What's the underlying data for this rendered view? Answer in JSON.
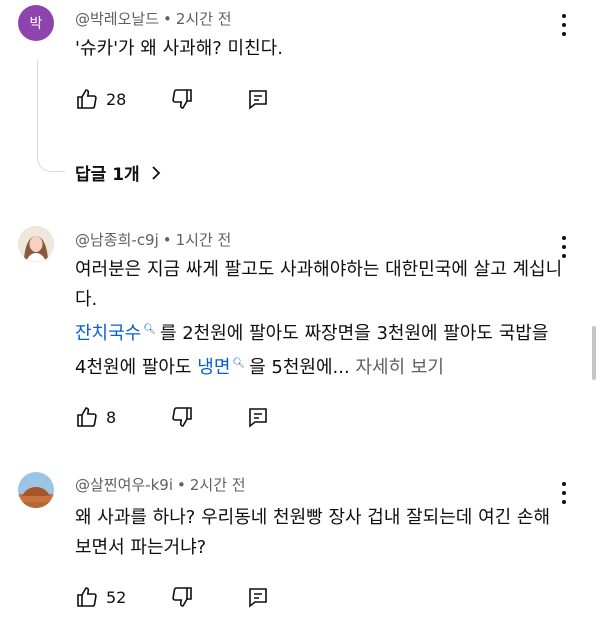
{
  "comments": [
    {
      "avatar_initial": "박",
      "avatar_color": "#8e44ad",
      "author": "@박레오날드",
      "time": "2시간 전",
      "text": "'슈카'가 왜 사과해? 미친다.",
      "likes": "28",
      "replies_label": "답글 1개"
    },
    {
      "author": "@남종희-c9j",
      "time": "1시간 전",
      "text_part1": "여러분은 지금 싸게 팔고도 사과해야하는 대한민국에 살고 계십니다.",
      "link1": "잔치국수",
      "text_part2": "를 2천원에 팔아도 짜장면을 3천원에 팔아도 국밥을 4천원에 팔아도",
      "link2": "냉면",
      "text_part3": "을 5천원에...",
      "more_label": "자세히 보기",
      "likes": "8"
    },
    {
      "author": "@살찐여우-k9i",
      "time": "2시간 전",
      "text": "왜 사과를 하나? 우리동네 천원빵 장사 겁내 잘되는데 여긴 손해보면서 파는거냐?",
      "likes": "52"
    }
  ],
  "colors": {
    "link": "#065fd4",
    "meta": "#606060",
    "text": "#0f0f0f"
  }
}
